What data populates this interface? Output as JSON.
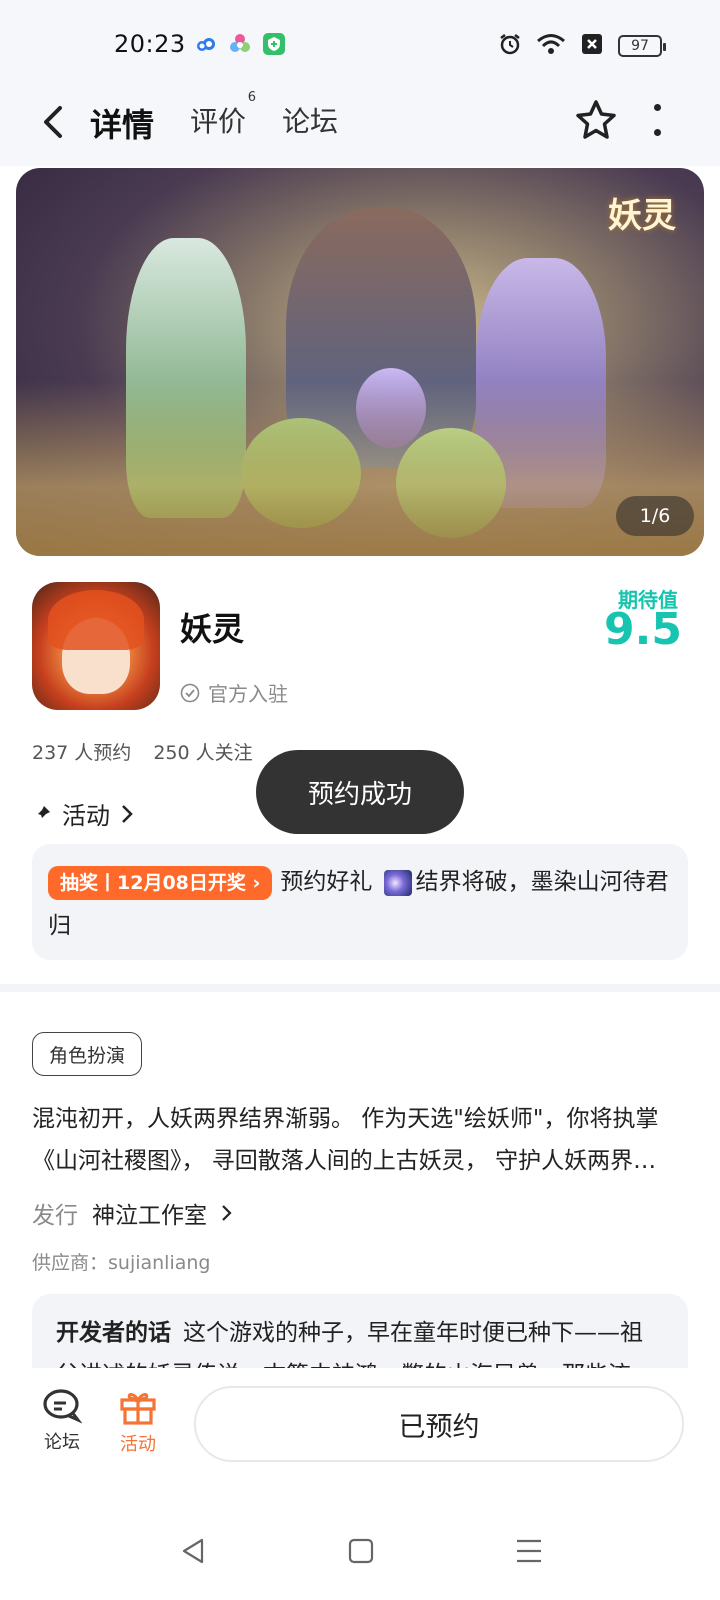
{
  "status_bar": {
    "time": "20:23",
    "battery": "97",
    "icons": [
      "cloud-app-icon",
      "flower-app-icon",
      "shield-app-icon",
      "alarm-icon",
      "wifi-icon",
      "sim-off-icon"
    ]
  },
  "nav": {
    "tabs": [
      {
        "label": "详情",
        "active": true
      },
      {
        "label": "评价",
        "badge": "6"
      },
      {
        "label": "论坛"
      }
    ]
  },
  "banner": {
    "logo_text": "妖灵",
    "page_indicator": "1/6"
  },
  "game": {
    "name": "妖灵",
    "official_label": "官方入驻",
    "expectation_label": "期待值",
    "expectation_score": "9.5",
    "reservations": "237 人预约",
    "followers": "250 人关注"
  },
  "activity": {
    "label": "活动",
    "badge": "抽奖丨12月08日开奖",
    "text_before_icon": "预约好礼",
    "text_after_icon": "结界将破，墨染山河待君归"
  },
  "toast": {
    "text": "预约成功"
  },
  "details": {
    "genre": "角色扮演",
    "description": "混沌初开，人妖两界结界渐弱。 作为天选\"绘妖师\"，你将执掌《山河社稷图》， 寻回散落人间的上古妖灵， 守护人妖两界…",
    "publisher_key": "发行",
    "publisher_value": "神泣工作室",
    "supplier": "供应商：sujianliang",
    "developer_title": "开发者的话",
    "developer_text": "这个游戏的种子，早在童年时便已种下——祖父讲述的妖灵传说，古籍中神鸿一瞥的山海异兽，那些流"
  },
  "bottom_bar": {
    "forum_label": "论坛",
    "activity_label": "活动",
    "reserved_button": "已预约"
  },
  "colors": {
    "accent": "#17c4b0",
    "tab_underline": "#1fd1c0",
    "promo_badge": "#ff6a2a",
    "activity_active": "#f47436",
    "toast_bg": "#333333"
  }
}
